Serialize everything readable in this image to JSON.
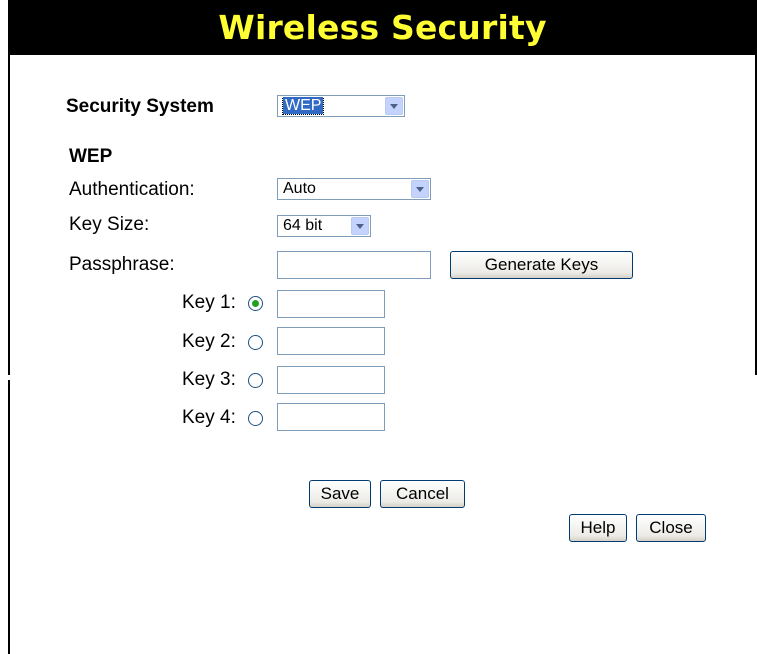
{
  "header": {
    "title": "Wireless Security"
  },
  "security_system": {
    "label": "Security System",
    "selected": "WEP"
  },
  "wep": {
    "section_title": "WEP",
    "authentication": {
      "label": "Authentication:",
      "selected": "Auto"
    },
    "key_size": {
      "label": "Key Size:",
      "selected": "64 bit"
    },
    "passphrase": {
      "label": "Passphrase:",
      "value": "",
      "generate_label": "Generate Keys"
    },
    "keys": [
      {
        "label": "Key 1:",
        "selected": true,
        "value": ""
      },
      {
        "label": "Key 2:",
        "selected": false,
        "value": ""
      },
      {
        "label": "Key 3:",
        "selected": false,
        "value": ""
      },
      {
        "label": "Key 4:",
        "selected": false,
        "value": ""
      }
    ]
  },
  "actions": {
    "save": "Save",
    "cancel": "Cancel",
    "help": "Help",
    "close": "Close"
  },
  "icons": {
    "dropdown": "chevron-down-icon",
    "radio": "radio-icon"
  },
  "colors": {
    "header_bg": "#000000",
    "header_text": "#ffff33",
    "radio_dot": "#21a121",
    "select_highlight": "#316ac5"
  }
}
